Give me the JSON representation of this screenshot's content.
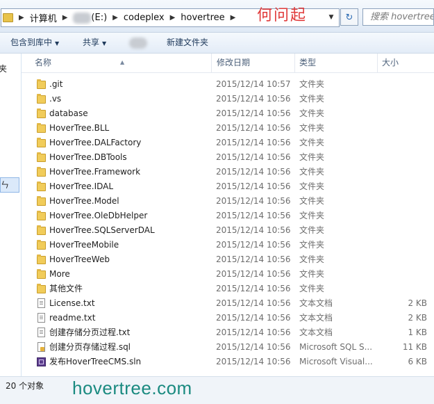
{
  "address": {
    "crumbs": [
      "计算机",
      "(E:)",
      "codeplex",
      "hovertree"
    ],
    "search_placeholder": "搜索 hovertree"
  },
  "watermark": "何问起",
  "toolbar": {
    "include_library": "包含到库中",
    "share": "共享",
    "new_folder": "新建文件夹"
  },
  "nav": {
    "item_top": "夹",
    "item_sel": "ㄣ"
  },
  "columns": {
    "name": "名称",
    "date": "修改日期",
    "type": "类型",
    "size": "大小"
  },
  "files": [
    {
      "name": ".git",
      "date": "2015/12/14 10:57",
      "type": "文件夹",
      "size": "",
      "icon": "folder"
    },
    {
      "name": ".vs",
      "date": "2015/12/14 10:56",
      "type": "文件夹",
      "size": "",
      "icon": "folder"
    },
    {
      "name": "database",
      "date": "2015/12/14 10:56",
      "type": "文件夹",
      "size": "",
      "icon": "folder"
    },
    {
      "name": "HoverTree.BLL",
      "date": "2015/12/14 10:56",
      "type": "文件夹",
      "size": "",
      "icon": "folder"
    },
    {
      "name": "HoverTree.DALFactory",
      "date": "2015/12/14 10:56",
      "type": "文件夹",
      "size": "",
      "icon": "folder"
    },
    {
      "name": "HoverTree.DBTools",
      "date": "2015/12/14 10:56",
      "type": "文件夹",
      "size": "",
      "icon": "folder"
    },
    {
      "name": "HoverTree.Framework",
      "date": "2015/12/14 10:56",
      "type": "文件夹",
      "size": "",
      "icon": "folder"
    },
    {
      "name": "HoverTree.IDAL",
      "date": "2015/12/14 10:56",
      "type": "文件夹",
      "size": "",
      "icon": "folder"
    },
    {
      "name": "HoverTree.Model",
      "date": "2015/12/14 10:56",
      "type": "文件夹",
      "size": "",
      "icon": "folder"
    },
    {
      "name": "HoverTree.OleDbHelper",
      "date": "2015/12/14 10:56",
      "type": "文件夹",
      "size": "",
      "icon": "folder"
    },
    {
      "name": "HoverTree.SQLServerDAL",
      "date": "2015/12/14 10:56",
      "type": "文件夹",
      "size": "",
      "icon": "folder"
    },
    {
      "name": "HoverTreeMobile",
      "date": "2015/12/14 10:56",
      "type": "文件夹",
      "size": "",
      "icon": "folder"
    },
    {
      "name": "HoverTreeWeb",
      "date": "2015/12/14 10:56",
      "type": "文件夹",
      "size": "",
      "icon": "folder"
    },
    {
      "name": "More",
      "date": "2015/12/14 10:56",
      "type": "文件夹",
      "size": "",
      "icon": "folder"
    },
    {
      "name": "其他文件",
      "date": "2015/12/14 10:56",
      "type": "文件夹",
      "size": "",
      "icon": "folder"
    },
    {
      "name": "License.txt",
      "date": "2015/12/14 10:56",
      "type": "文本文档",
      "size": "2 KB",
      "icon": "txt"
    },
    {
      "name": "readme.txt",
      "date": "2015/12/14 10:56",
      "type": "文本文档",
      "size": "2 KB",
      "icon": "txt"
    },
    {
      "name": "创建存储分页过程.txt",
      "date": "2015/12/14 10:56",
      "type": "文本文档",
      "size": "1 KB",
      "icon": "txt"
    },
    {
      "name": "创建分页存储过程.sql",
      "date": "2015/12/14 10:56",
      "type": "Microsoft SQL S...",
      "size": "11 KB",
      "icon": "sql"
    },
    {
      "name": "发布HoverTreeCMS.sln",
      "date": "2015/12/14 10:56",
      "type": "Microsoft Visual...",
      "size": "6 KB",
      "icon": "sln"
    }
  ],
  "status": {
    "count": "20 个对象"
  },
  "brand": "hovertree.com"
}
